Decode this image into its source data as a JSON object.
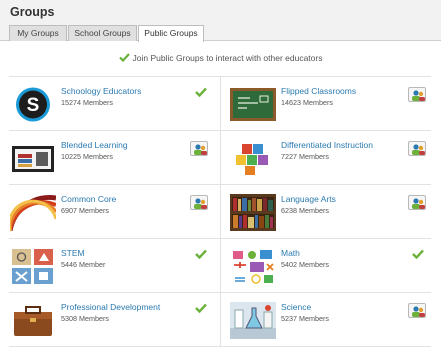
{
  "page_title": "Groups",
  "tabs": [
    {
      "label": "My Groups",
      "active": false
    },
    {
      "label": "School Groups",
      "active": false
    },
    {
      "label": "Public Groups",
      "active": true
    }
  ],
  "join_notice": "Join Public Groups to interact with other educators",
  "colors": {
    "link": "#2a7ab0",
    "check": "#6bb13a"
  },
  "groups": [
    {
      "name": "Schoology Educators",
      "members": "15274 Members",
      "status": "joined",
      "icon": "schoology-logo-icon"
    },
    {
      "name": "Flipped Classrooms",
      "members": "14623 Members",
      "status": "join",
      "icon": "chalkboard-icon"
    },
    {
      "name": "Blended Learning",
      "members": "10225 Members",
      "status": "join",
      "icon": "books-icon"
    },
    {
      "name": "Differentiated Instruction",
      "members": "7227 Members",
      "status": "join",
      "icon": "puzzle-icon"
    },
    {
      "name": "Common Core",
      "members": "6907 Members",
      "status": "join",
      "icon": "arcs-icon"
    },
    {
      "name": "Language Arts",
      "members": "6238 Members",
      "status": "join",
      "icon": "bookshelf-icon"
    },
    {
      "name": "STEM",
      "members": "5446 Member",
      "status": "joined",
      "icon": "stem-icon"
    },
    {
      "name": "Math",
      "members": "5402 Members",
      "status": "joined",
      "icon": "math-icon"
    },
    {
      "name": "Professional Development",
      "members": "5308 Members",
      "status": "joined",
      "icon": "briefcase-icon"
    },
    {
      "name": "Science",
      "members": "5237 Members",
      "status": "join",
      "icon": "science-icon"
    }
  ]
}
